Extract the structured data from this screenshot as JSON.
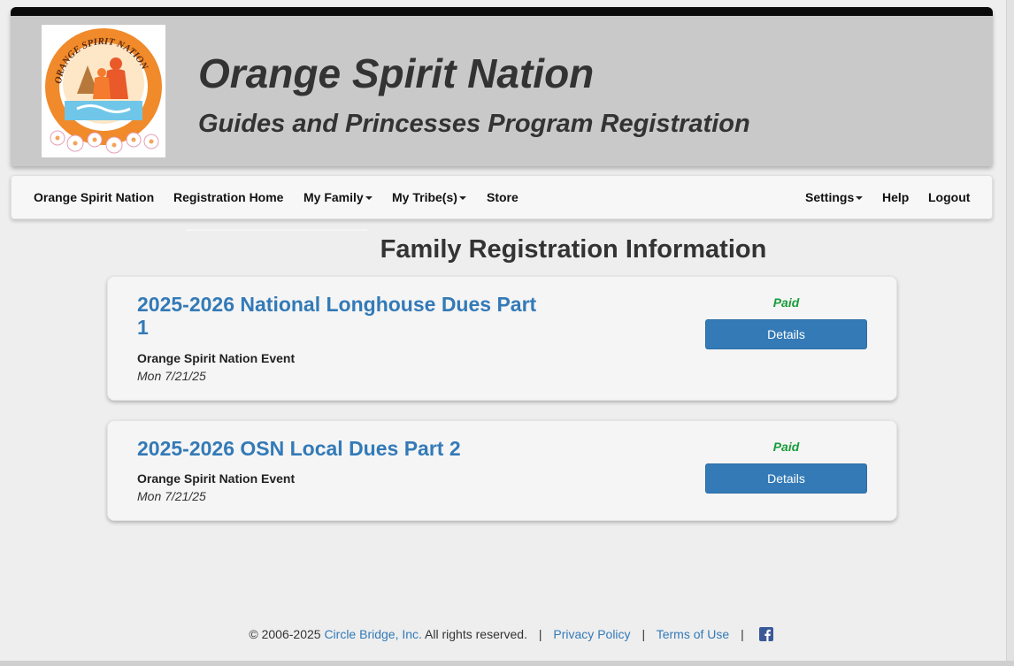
{
  "header": {
    "title": "Orange Spirit Nation",
    "subtitle": "Guides and Princesses Program Registration",
    "logo_text": "ORANGE SPIRIT NATION"
  },
  "nav": {
    "left": [
      {
        "label": "Orange Spirit Nation",
        "dropdown": false
      },
      {
        "label": "Registration Home",
        "dropdown": false
      },
      {
        "label": "My Family",
        "dropdown": true
      },
      {
        "label": "My Tribe(s)",
        "dropdown": true
      },
      {
        "label": "Store",
        "dropdown": false
      }
    ],
    "right": [
      {
        "label": "Settings",
        "dropdown": true
      },
      {
        "label": "Help",
        "dropdown": false
      },
      {
        "label": "Logout",
        "dropdown": false
      }
    ]
  },
  "main": {
    "heading": "Family Registration Information",
    "cards": [
      {
        "title": "2025-2026 National Longhouse Dues Part 1",
        "subtitle": "Orange Spirit Nation Event",
        "date": "Mon 7/21/25",
        "status": "Paid",
        "button": "Details"
      },
      {
        "title": "2025-2026 OSN Local Dues Part 2",
        "subtitle": "Orange Spirit Nation Event",
        "date": "Mon 7/21/25",
        "status": "Paid",
        "button": "Details"
      }
    ]
  },
  "footer": {
    "copyright": "© 2006-2025",
    "company_link": "Circle Bridge, Inc.",
    "rights": "All rights reserved.",
    "separator": "|",
    "privacy_link": "Privacy Policy",
    "terms_link": "Terms of Use",
    "social_icon": "facebook-icon"
  },
  "colors": {
    "link": "#337ab7",
    "paid": "#1a9c3a",
    "banner": "#c9c9c9",
    "button": "#337ab7"
  }
}
